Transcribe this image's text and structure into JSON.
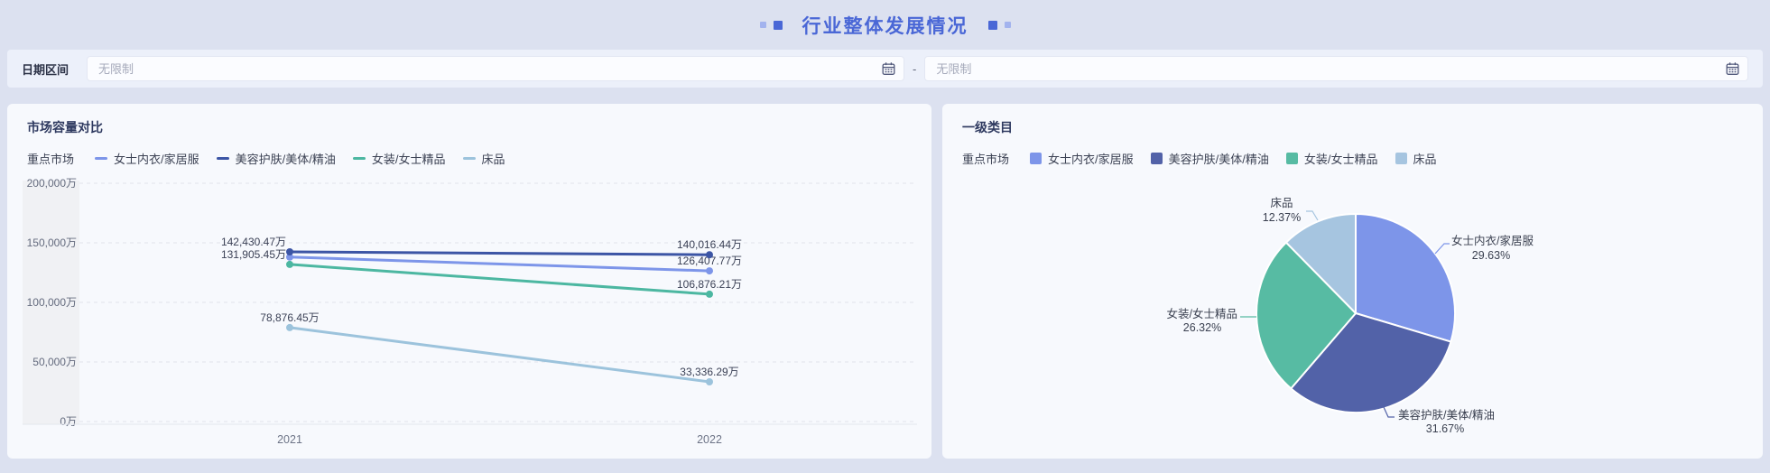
{
  "header": {
    "title": "行业整体发展情况"
  },
  "filter": {
    "label": "日期区间",
    "start_value": "",
    "start_placeholder": "无限制",
    "end_value": "",
    "end_placeholder": "无限制",
    "separator": "-"
  },
  "market_chart": {
    "title": "市场容量对比",
    "legend_title": "重点市场"
  },
  "category_chart": {
    "title": "一级类目",
    "legend_title": "重点市场"
  },
  "colors": {
    "page_background": "#dce1f0",
    "panel_background": "#ecf0fa",
    "card_background": "#f7f9fd",
    "accent": "#4a67d6",
    "accent_light": "#a3b3ee",
    "grid_line": "#e1e4eb",
    "axis_text": "#646b7e",
    "value_label_text": "#3b4156"
  },
  "chart_data": [
    {
      "type": "line",
      "title": "市场容量对比",
      "legend_title": "重点市场",
      "legend_position": "top",
      "grid": "dashed-horizontal",
      "x": [
        "2021",
        "2022"
      ],
      "ylim": [
        0,
        200000
      ],
      "yticks": [
        "0万",
        "50,000万",
        "100,000万",
        "150,000万",
        "200,000万"
      ],
      "series": [
        {
          "name": "女士内衣/家居服",
          "color": "#7d95e9",
          "values": [
            138000,
            126407.77
          ],
          "labels": [
            "",
            "126,407.77万"
          ]
        },
        {
          "name": "美容护肤/美体/精油",
          "color": "#3c55a5",
          "values": [
            142430.47,
            140016.44
          ],
          "labels": [
            "142,430.47万",
            "140,016.44万"
          ]
        },
        {
          "name": "女装/女士精品",
          "color": "#4cb7a1",
          "values": [
            131905.45,
            106876.21
          ],
          "labels": [
            "131,905.45万",
            "106,876.21万"
          ]
        },
        {
          "name": "床品",
          "color": "#9cc3dc",
          "values": [
            78876.45,
            33336.29
          ],
          "labels": [
            "78,876.45万",
            "33,336.29万"
          ]
        }
      ]
    },
    {
      "type": "pie",
      "title": "一级类目",
      "legend_title": "重点市场",
      "legend_position": "top",
      "direction": "clockwise",
      "start_angle": "12-oclock",
      "slices": [
        {
          "name": "女士内衣/家居服",
          "value_pct": 29.63,
          "label": "29.63%",
          "color": "#7d95e9"
        },
        {
          "name": "美容护肤/美体/精油",
          "value_pct": 31.67,
          "label": "31.67%",
          "color": "#5262a8"
        },
        {
          "name": "女装/女士精品",
          "value_pct": 26.32,
          "label": "26.32%",
          "color": "#57bba3"
        },
        {
          "name": "床品",
          "value_pct": 12.37,
          "label": "12.37%",
          "color": "#a6c5e0"
        }
      ]
    }
  ]
}
